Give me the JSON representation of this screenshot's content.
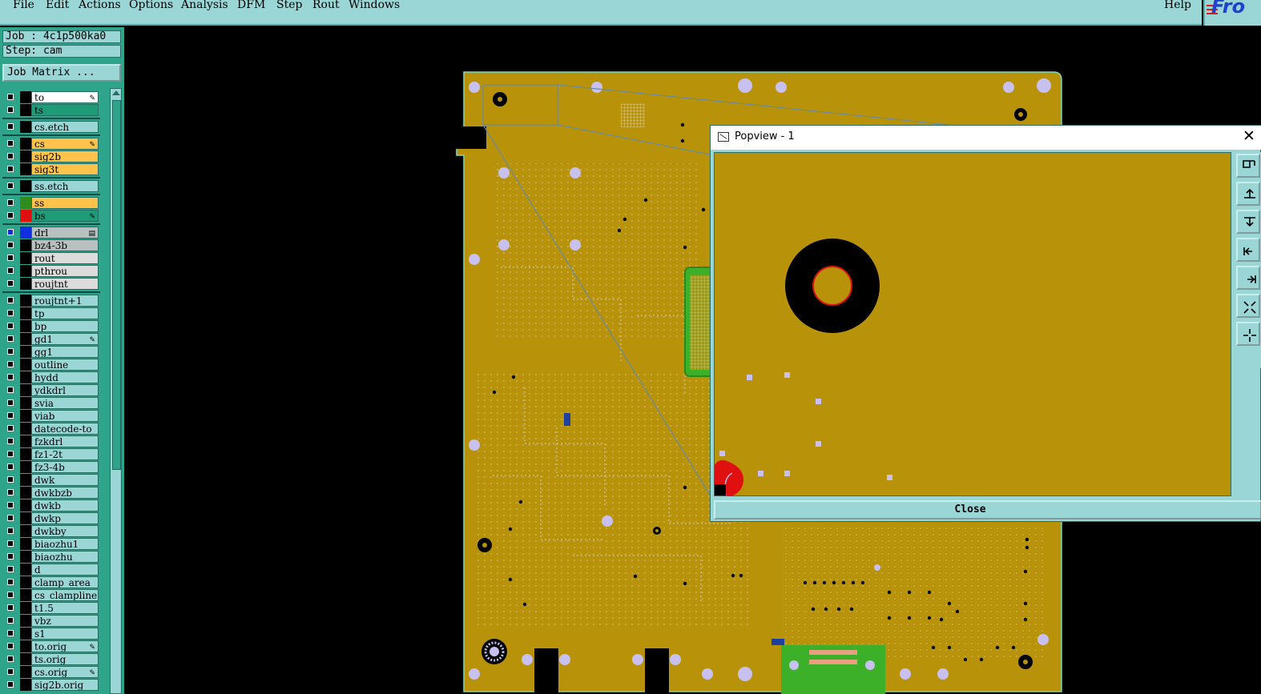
{
  "menubar": {
    "items": [
      "File",
      "Edit",
      "Actions",
      "Options",
      "Analysis",
      "DFM",
      "Step",
      "Rout",
      "Windows"
    ],
    "help": "Help",
    "logo": "Fro"
  },
  "panel": {
    "job": "Job : 4c1p500ka0",
    "step": "Step: cam",
    "job_matrix_button": "Job Matrix ..."
  },
  "layers": [
    {
      "name": "to",
      "bg": "#ffffff",
      "swatch": "#000000",
      "mark": "pen"
    },
    {
      "name": "ts",
      "bg": "#1e9c78",
      "swatch": "#000000",
      "mark": ""
    },
    {
      "name": "cs.etch",
      "bg": "#9ad6d6",
      "swatch": "#000000",
      "mark": ""
    },
    {
      "name": "cs",
      "bg": "#ffc24a",
      "swatch": "#000000",
      "mark": "pen"
    },
    {
      "name": "sig2b",
      "bg": "#ffc24a",
      "swatch": "#000000",
      "mark": ""
    },
    {
      "name": "sig3t",
      "bg": "#ffc24a",
      "swatch": "#000000",
      "mark": ""
    },
    {
      "name": "ss.etch",
      "bg": "#9ad6d6",
      "swatch": "#000000",
      "mark": ""
    },
    {
      "name": "ss",
      "bg": "#ffc24a",
      "swatch": "#2e8b1e",
      "mark": ""
    },
    {
      "name": "bs",
      "bg": "#1e9c78",
      "swatch": "#e01010",
      "mark": "pen"
    },
    {
      "name": "drl",
      "bg": "#b8c0c0",
      "swatch": "#1030e0",
      "mark": "grid"
    },
    {
      "name": "bz4-3b",
      "bg": "#b8c0c0",
      "swatch": "#000000",
      "mark": ""
    },
    {
      "name": "rout",
      "bg": "#dcdcdc",
      "swatch": "#000000",
      "mark": ""
    },
    {
      "name": "pthrou",
      "bg": "#dcdcdc",
      "swatch": "#000000",
      "mark": ""
    },
    {
      "name": "roujtnt",
      "bg": "#dcdcdc",
      "swatch": "#000000",
      "mark": ""
    },
    {
      "name": "roujtnt+1",
      "bg": "#9ad6d6",
      "swatch": "#000000",
      "mark": ""
    },
    {
      "name": "tp",
      "bg": "#9ad6d6",
      "swatch": "#000000",
      "mark": ""
    },
    {
      "name": "bp",
      "bg": "#9ad6d6",
      "swatch": "#000000",
      "mark": ""
    },
    {
      "name": "gd1",
      "bg": "#9ad6d6",
      "swatch": "#000000",
      "mark": "pen"
    },
    {
      "name": "gg1",
      "bg": "#9ad6d6",
      "swatch": "#000000",
      "mark": ""
    },
    {
      "name": "outline",
      "bg": "#9ad6d6",
      "swatch": "#000000",
      "mark": ""
    },
    {
      "name": "hydd",
      "bg": "#9ad6d6",
      "swatch": "#000000",
      "mark": ""
    },
    {
      "name": "ydkdrl",
      "bg": "#9ad6d6",
      "swatch": "#000000",
      "mark": ""
    },
    {
      "name": "svia",
      "bg": "#9ad6d6",
      "swatch": "#000000",
      "mark": ""
    },
    {
      "name": "viab",
      "bg": "#9ad6d6",
      "swatch": "#000000",
      "mark": ""
    },
    {
      "name": "datecode-to",
      "bg": "#9ad6d6",
      "swatch": "#000000",
      "mark": ""
    },
    {
      "name": "fzkdrl",
      "bg": "#9ad6d6",
      "swatch": "#000000",
      "mark": ""
    },
    {
      "name": "fz1-2t",
      "bg": "#9ad6d6",
      "swatch": "#000000",
      "mark": ""
    },
    {
      "name": "fz3-4b",
      "bg": "#9ad6d6",
      "swatch": "#000000",
      "mark": ""
    },
    {
      "name": "dwk",
      "bg": "#9ad6d6",
      "swatch": "#000000",
      "mark": ""
    },
    {
      "name": "dwkbzb",
      "bg": "#9ad6d6",
      "swatch": "#000000",
      "mark": ""
    },
    {
      "name": "dwkb",
      "bg": "#9ad6d6",
      "swatch": "#000000",
      "mark": ""
    },
    {
      "name": "dwkp",
      "bg": "#9ad6d6",
      "swatch": "#000000",
      "mark": ""
    },
    {
      "name": "dwkby",
      "bg": "#9ad6d6",
      "swatch": "#000000",
      "mark": ""
    },
    {
      "name": "biaozhu1",
      "bg": "#9ad6d6",
      "swatch": "#000000",
      "mark": ""
    },
    {
      "name": "biaozhu",
      "bg": "#9ad6d6",
      "swatch": "#000000",
      "mark": ""
    },
    {
      "name": "d",
      "bg": "#9ad6d6",
      "swatch": "#000000",
      "mark": ""
    },
    {
      "name": "clamp_area",
      "bg": "#9ad6d6",
      "swatch": "#000000",
      "mark": ""
    },
    {
      "name": "cs_clampline",
      "bg": "#9ad6d6",
      "swatch": "#000000",
      "mark": ""
    },
    {
      "name": "t1.5",
      "bg": "#9ad6d6",
      "swatch": "#000000",
      "mark": ""
    },
    {
      "name": "vbz",
      "bg": "#9ad6d6",
      "swatch": "#000000",
      "mark": ""
    },
    {
      "name": "s1",
      "bg": "#9ad6d6",
      "swatch": "#000000",
      "mark": ""
    },
    {
      "name": "to.orig",
      "bg": "#9ad6d6",
      "swatch": "#000000",
      "mark": "pen"
    },
    {
      "name": "ts.orig",
      "bg": "#9ad6d6",
      "swatch": "#000000",
      "mark": ""
    },
    {
      "name": "cs.orig",
      "bg": "#9ad6d6",
      "swatch": "#000000",
      "mark": "pen"
    },
    {
      "name": "sig2b.orig",
      "bg": "#9ad6d6",
      "swatch": "#000000",
      "mark": ""
    }
  ],
  "colors": {
    "board": "#b8930a",
    "pad": "#c8c0ee",
    "hole": "#000000",
    "copper_green": "#3cb028",
    "highlight_red": "#e01010"
  },
  "popview": {
    "title": "Popview - 1",
    "close_label": "Close",
    "tools": [
      "zoom-fit-icon",
      "pan-up-icon",
      "pan-down-icon",
      "pan-left-icon",
      "pan-right-icon",
      "zoom-out-icon",
      "zoom-in-icon"
    ]
  }
}
